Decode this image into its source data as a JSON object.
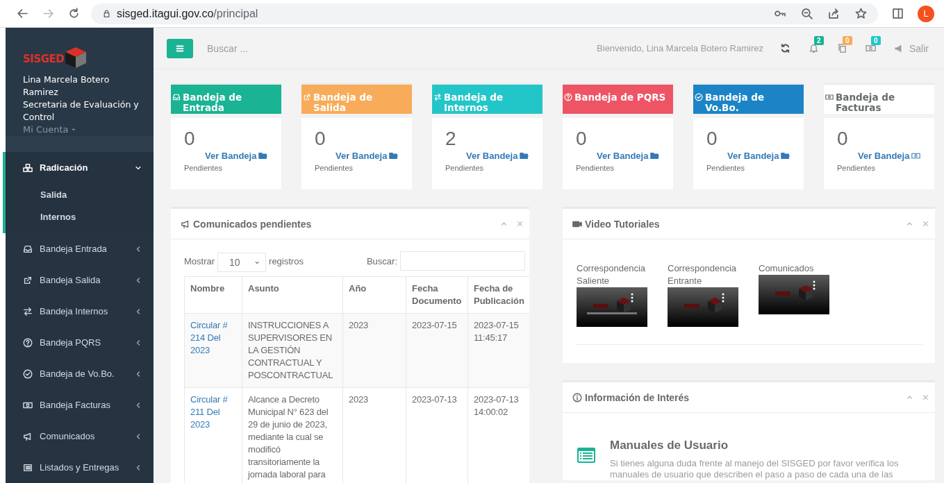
{
  "browser": {
    "url_host": "sisged.itagui.gov.co",
    "url_path": "/principal",
    "avatar": "L"
  },
  "sidebar": {
    "logo": "SISGED",
    "user_name": "Lina Marcela Botero Ramirez",
    "department": "Secretaria de Evaluación y Control",
    "account_link": "Mi Cuenta",
    "items": [
      {
        "label": "Radicación",
        "selected": true,
        "expanded": true,
        "children": [
          {
            "label": "Salida",
            "selected": false
          },
          {
            "label": "Internos",
            "selected": false
          }
        ]
      },
      {
        "label": "Bandeja Entrada",
        "selected": false,
        "expanded": false
      },
      {
        "label": "Bandeja Salida",
        "selected": false,
        "expanded": false
      },
      {
        "label": "Bandeja Internos",
        "selected": false,
        "expanded": false
      },
      {
        "label": "Bandeja PQRS",
        "selected": false,
        "expanded": false
      },
      {
        "label": "Bandeja de Vo.Bo.",
        "selected": false,
        "expanded": false
      },
      {
        "label": "Bandeja Facturas",
        "selected": false,
        "expanded": false
      },
      {
        "label": "Comunicados",
        "selected": false,
        "expanded": false
      },
      {
        "label": "Listados y Entregas",
        "selected": false,
        "expanded": false
      }
    ]
  },
  "header": {
    "search_placeholder": "Buscar ...",
    "welcome": "Bienvenido, Lina Marcela Botero Ramirez",
    "notifications": [
      {
        "count": "2",
        "color": "#1ab394"
      },
      {
        "count": "0",
        "color": "#f8ac59"
      },
      {
        "count": "0",
        "color": "#23c6c8"
      }
    ],
    "logout": "Salir"
  },
  "inbox_cards": [
    {
      "title": "Bandeja de Entrada",
      "color": "#1ab394",
      "count": "0",
      "link": "Ver Bandeja",
      "footer": "Pendientes"
    },
    {
      "title": "Bandeja de Salida",
      "color": "#f8ac59",
      "count": "0",
      "link": "Ver Bandeja",
      "footer": "Pendientes"
    },
    {
      "title": "Bandeja de Internos",
      "color": "#23c6c8",
      "count": "2",
      "link": "Ver Bandeja",
      "footer": "Pendientes"
    },
    {
      "title": "Bandeja de PQRS",
      "color": "#ed5565",
      "count": "0",
      "link": "Ver Bandeja",
      "footer": "Pendientes"
    },
    {
      "title": "Bandeja de Vo.Bo.",
      "color": "#1c84c6",
      "count": "0",
      "link": "Ver Bandeja",
      "footer": "Pendientes"
    },
    {
      "title": "Bandeja de Facturas",
      "color": "#ffffff",
      "count": "0",
      "link": "Ver Bandeja",
      "footer": "Pendientes"
    }
  ],
  "comunicados": {
    "title": "Comunicados pendientes",
    "show_label": "Mostrar",
    "page_size": "10",
    "records_label": "registros",
    "search_label": "Buscar:",
    "columns": [
      "Nombre",
      "Asunto",
      "Año",
      "Fecha Documento",
      "Fecha de Publicación"
    ],
    "rows": [
      {
        "cells": [
          "Circular # 214 Del 2023",
          "INSTRUCCIONES A SUPERVISORES EN LA GESTIÓN CONTRACTUAL Y POSCONTRACTUAL",
          "2023",
          "2023-07-15",
          "2023-07-15 11:45:17"
        ]
      },
      {
        "cells": [
          "Circular # 211 Del 2023",
          "Alcance a Decreto Municipal N° 623 del 29 de junio de 2023, mediante la cual se modificó transitoriamente la jornada laboral para",
          "2023",
          "2023-07-13",
          "2023-07-13 14:00:02"
        ]
      }
    ]
  },
  "videos": {
    "title": "Video Tutoriales",
    "items": [
      {
        "title": "Correspondencia Saliente"
      },
      {
        "title": "Correspondencia Entrante"
      },
      {
        "title": "Comunicados"
      }
    ]
  },
  "info": {
    "title": "Información de Interés",
    "items": [
      {
        "heading": "Manuales de Usuario",
        "text": "Si tienes alguna duda frente al manejo del SISGED por favor verifica los manuales de usuario que describen el paso a paso de cada una de las"
      }
    ]
  }
}
